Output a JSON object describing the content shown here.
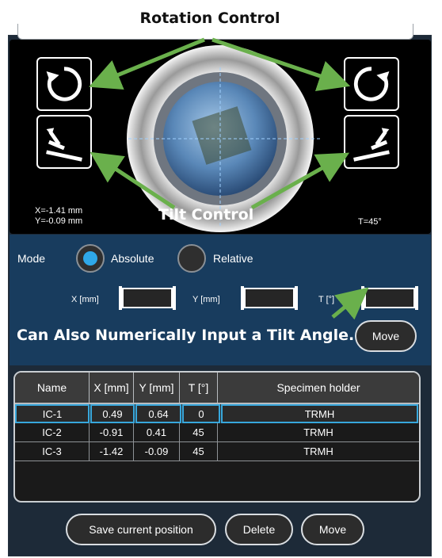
{
  "annotations": {
    "rotation_control": "Rotation Control",
    "tilt_control": "Tilt Control",
    "tilt_note": "Can Also Numerically Input a Tilt Angle."
  },
  "viewer": {
    "coord_x": "X=-1.41 mm",
    "coord_y": "Y=-0.09 mm",
    "tilt": "T=45°"
  },
  "mode": {
    "label": "Mode",
    "options": [
      {
        "label": "Absolute",
        "selected": true
      },
      {
        "label": "Relative",
        "selected": false
      }
    ]
  },
  "inputs": {
    "x_label": "X [mm]",
    "y_label": "Y [mm]",
    "t_label": "T [°]",
    "x_value": "",
    "y_value": "",
    "t_value": ""
  },
  "move_label": "Move",
  "table": {
    "columns": [
      "Name",
      "X [mm]",
      "Y [mm]",
      "T [°]",
      "Specimen holder"
    ],
    "rows": [
      [
        "IC-1",
        "0.49",
        "0.64",
        "0",
        "TRMH"
      ],
      [
        "IC-2",
        "-0.91",
        "0.41",
        "45",
        "TRMH"
      ],
      [
        "IC-3",
        "-1.42",
        "-0.09",
        "45",
        "TRMH"
      ]
    ]
  },
  "footer": {
    "save": "Save current position",
    "delete": "Delete",
    "move": "Move"
  },
  "colors": {
    "accent": "#2fa8e8",
    "annotation_arrow": "#6ab04c",
    "panel": "#183c5e"
  }
}
